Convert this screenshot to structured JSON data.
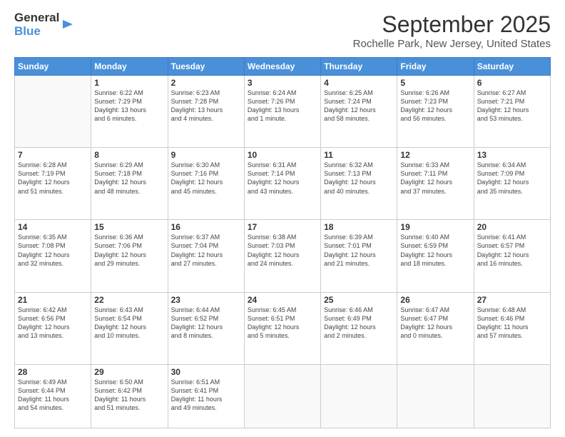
{
  "header": {
    "logo_line1": "General",
    "logo_line2": "Blue",
    "title": "September 2025",
    "subtitle": "Rochelle Park, New Jersey, United States"
  },
  "days_of_week": [
    "Sunday",
    "Monday",
    "Tuesday",
    "Wednesday",
    "Thursday",
    "Friday",
    "Saturday"
  ],
  "weeks": [
    [
      {
        "day": "",
        "info": ""
      },
      {
        "day": "1",
        "info": "Sunrise: 6:22 AM\nSunset: 7:29 PM\nDaylight: 13 hours\nand 6 minutes."
      },
      {
        "day": "2",
        "info": "Sunrise: 6:23 AM\nSunset: 7:28 PM\nDaylight: 13 hours\nand 4 minutes."
      },
      {
        "day": "3",
        "info": "Sunrise: 6:24 AM\nSunset: 7:26 PM\nDaylight: 13 hours\nand 1 minute."
      },
      {
        "day": "4",
        "info": "Sunrise: 6:25 AM\nSunset: 7:24 PM\nDaylight: 12 hours\nand 58 minutes."
      },
      {
        "day": "5",
        "info": "Sunrise: 6:26 AM\nSunset: 7:23 PM\nDaylight: 12 hours\nand 56 minutes."
      },
      {
        "day": "6",
        "info": "Sunrise: 6:27 AM\nSunset: 7:21 PM\nDaylight: 12 hours\nand 53 minutes."
      }
    ],
    [
      {
        "day": "7",
        "info": "Sunrise: 6:28 AM\nSunset: 7:19 PM\nDaylight: 12 hours\nand 51 minutes."
      },
      {
        "day": "8",
        "info": "Sunrise: 6:29 AM\nSunset: 7:18 PM\nDaylight: 12 hours\nand 48 minutes."
      },
      {
        "day": "9",
        "info": "Sunrise: 6:30 AM\nSunset: 7:16 PM\nDaylight: 12 hours\nand 45 minutes."
      },
      {
        "day": "10",
        "info": "Sunrise: 6:31 AM\nSunset: 7:14 PM\nDaylight: 12 hours\nand 43 minutes."
      },
      {
        "day": "11",
        "info": "Sunrise: 6:32 AM\nSunset: 7:13 PM\nDaylight: 12 hours\nand 40 minutes."
      },
      {
        "day": "12",
        "info": "Sunrise: 6:33 AM\nSunset: 7:11 PM\nDaylight: 12 hours\nand 37 minutes."
      },
      {
        "day": "13",
        "info": "Sunrise: 6:34 AM\nSunset: 7:09 PM\nDaylight: 12 hours\nand 35 minutes."
      }
    ],
    [
      {
        "day": "14",
        "info": "Sunrise: 6:35 AM\nSunset: 7:08 PM\nDaylight: 12 hours\nand 32 minutes."
      },
      {
        "day": "15",
        "info": "Sunrise: 6:36 AM\nSunset: 7:06 PM\nDaylight: 12 hours\nand 29 minutes."
      },
      {
        "day": "16",
        "info": "Sunrise: 6:37 AM\nSunset: 7:04 PM\nDaylight: 12 hours\nand 27 minutes."
      },
      {
        "day": "17",
        "info": "Sunrise: 6:38 AM\nSunset: 7:03 PM\nDaylight: 12 hours\nand 24 minutes."
      },
      {
        "day": "18",
        "info": "Sunrise: 6:39 AM\nSunset: 7:01 PM\nDaylight: 12 hours\nand 21 minutes."
      },
      {
        "day": "19",
        "info": "Sunrise: 6:40 AM\nSunset: 6:59 PM\nDaylight: 12 hours\nand 18 minutes."
      },
      {
        "day": "20",
        "info": "Sunrise: 6:41 AM\nSunset: 6:57 PM\nDaylight: 12 hours\nand 16 minutes."
      }
    ],
    [
      {
        "day": "21",
        "info": "Sunrise: 6:42 AM\nSunset: 6:56 PM\nDaylight: 12 hours\nand 13 minutes."
      },
      {
        "day": "22",
        "info": "Sunrise: 6:43 AM\nSunset: 6:54 PM\nDaylight: 12 hours\nand 10 minutes."
      },
      {
        "day": "23",
        "info": "Sunrise: 6:44 AM\nSunset: 6:52 PM\nDaylight: 12 hours\nand 8 minutes."
      },
      {
        "day": "24",
        "info": "Sunrise: 6:45 AM\nSunset: 6:51 PM\nDaylight: 12 hours\nand 5 minutes."
      },
      {
        "day": "25",
        "info": "Sunrise: 6:46 AM\nSunset: 6:49 PM\nDaylight: 12 hours\nand 2 minutes."
      },
      {
        "day": "26",
        "info": "Sunrise: 6:47 AM\nSunset: 6:47 PM\nDaylight: 12 hours\nand 0 minutes."
      },
      {
        "day": "27",
        "info": "Sunrise: 6:48 AM\nSunset: 6:46 PM\nDaylight: 11 hours\nand 57 minutes."
      }
    ],
    [
      {
        "day": "28",
        "info": "Sunrise: 6:49 AM\nSunset: 6:44 PM\nDaylight: 11 hours\nand 54 minutes."
      },
      {
        "day": "29",
        "info": "Sunrise: 6:50 AM\nSunset: 6:42 PM\nDaylight: 11 hours\nand 51 minutes."
      },
      {
        "day": "30",
        "info": "Sunrise: 6:51 AM\nSunset: 6:41 PM\nDaylight: 11 hours\nand 49 minutes."
      },
      {
        "day": "",
        "info": ""
      },
      {
        "day": "",
        "info": ""
      },
      {
        "day": "",
        "info": ""
      },
      {
        "day": "",
        "info": ""
      }
    ]
  ]
}
